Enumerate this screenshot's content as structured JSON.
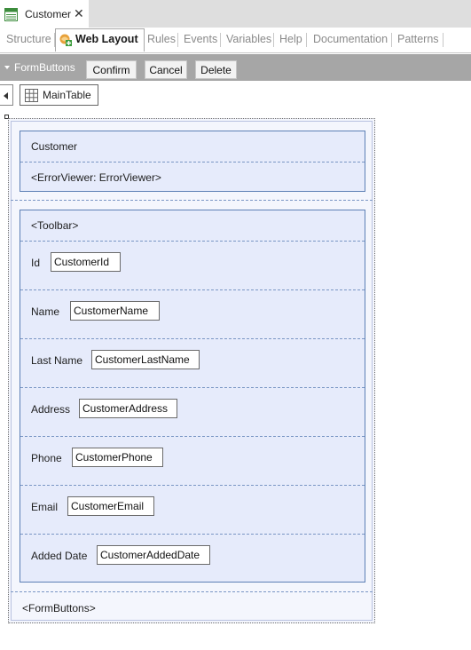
{
  "document_tab": {
    "title": "Customer",
    "close_glyph": "✕",
    "icon": "transaction-icon"
  },
  "part_tabs": [
    {
      "label": "Structure"
    },
    {
      "label": "Web Layout"
    },
    {
      "label": "Rules"
    },
    {
      "label": "Events"
    },
    {
      "label": "Variables"
    },
    {
      "label": "Help"
    },
    {
      "label": "Documentation"
    },
    {
      "label": "Patterns"
    }
  ],
  "form_buttons_bar": {
    "label": "FormButtons",
    "buttons": [
      {
        "label": "Confirm"
      },
      {
        "label": "Cancel"
      },
      {
        "label": "Delete"
      }
    ]
  },
  "main_table": {
    "label": "MainTable",
    "icon": "grid-icon"
  },
  "layout": {
    "header_group": {
      "title": "Customer",
      "error_viewer": "<ErrorViewer: ErrorViewer>"
    },
    "form_group": {
      "toolbar": "<Toolbar>",
      "fields": [
        {
          "label": "Id",
          "control": "CustomerId"
        },
        {
          "label": "Name",
          "control": "CustomerName"
        },
        {
          "label": "Last Name",
          "control": "CustomerLastName"
        },
        {
          "label": "Address",
          "control": "CustomerAddress"
        },
        {
          "label": "Phone",
          "control": "CustomerPhone"
        },
        {
          "label": "Email",
          "control": "CustomerEmail"
        },
        {
          "label": "Added Date",
          "control": "CustomerAddedDate"
        }
      ]
    },
    "form_buttons_placeholder": "<FormButtons>"
  },
  "colors": {
    "accent_active_tab": "#ffffff",
    "toolbar_bg": "#a6a6a6",
    "group_fill": "#e6ebfb",
    "group_border": "#5c7fb5"
  }
}
